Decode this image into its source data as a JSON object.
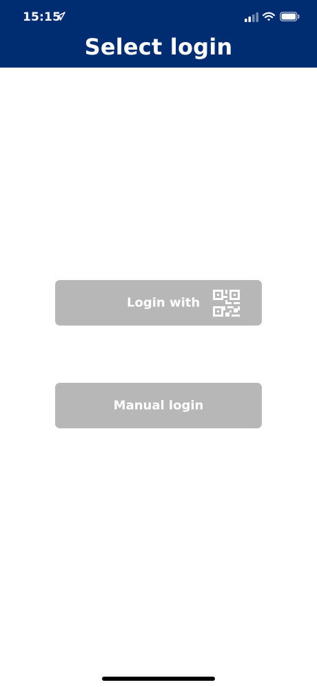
{
  "status_bar": {
    "time": "15:15",
    "icons": [
      "location-arrow-icon",
      "cellular-signal-icon",
      "wifi-icon",
      "battery-icon"
    ]
  },
  "header": {
    "title": "Select login",
    "background_color": "#002d72"
  },
  "buttons": {
    "qr_login": {
      "label": "Login with",
      "icon": "qr-code-icon"
    },
    "manual_login": {
      "label": "Manual login"
    },
    "background_color": "#b7b7b7",
    "text_color": "#ffffff"
  },
  "home_indicator": {
    "color": "#000000"
  }
}
